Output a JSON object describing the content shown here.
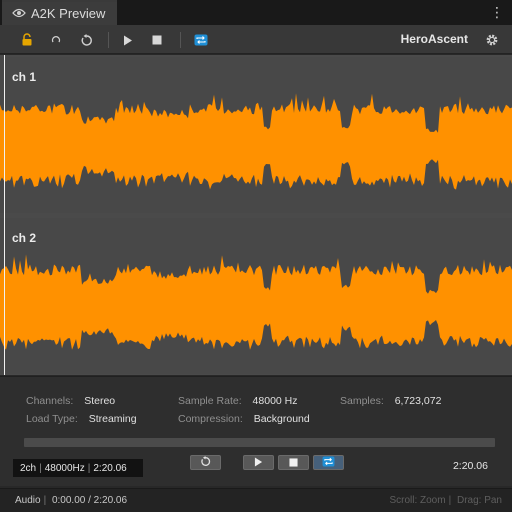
{
  "window": {
    "tab_title": "A2K Preview",
    "menu_icon": "kebab-icon"
  },
  "toolbar": {
    "buttons": [
      "lock-icon",
      "loop-small-icon",
      "refresh-icon",
      "play-icon",
      "stop-icon",
      "repeat-icon"
    ],
    "asset_name": "HeroAscent",
    "settings_icon": "gear-icon"
  },
  "waveform": {
    "color": "#ff9100",
    "channels": [
      {
        "label": "ch 1"
      },
      {
        "label": "ch 2"
      }
    ]
  },
  "info": {
    "channels_label": "Channels:",
    "channels_value": "Stereo",
    "sample_rate_label": "Sample Rate:",
    "sample_rate_value": "48000 Hz",
    "samples_label": "Samples:",
    "samples_value": "6,723,072",
    "load_type_label": "Load Type:",
    "load_type_value": "Streaming",
    "compression_label": "Compression:",
    "compression_value": "Background"
  },
  "player": {
    "format_channels": "2ch",
    "format_rate": "48000Hz",
    "format_length": "2:20.06",
    "duration": "2:20.06",
    "progress": 0.0
  },
  "status": {
    "type": "Audio",
    "position": "0:00.00 / 2:20.06",
    "hint_scroll": "Scroll: Zoom",
    "hint_drag": "Drag: Pan"
  }
}
